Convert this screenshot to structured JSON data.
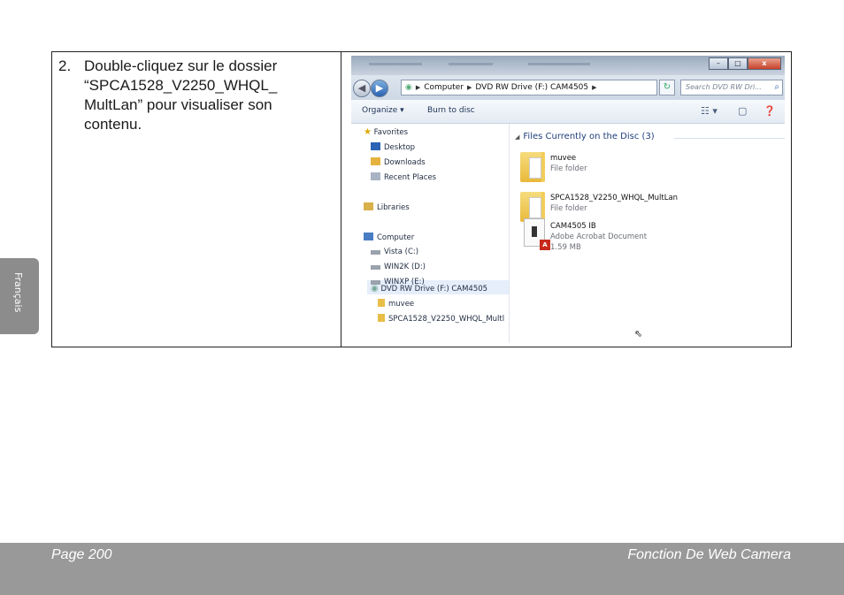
{
  "step": {
    "number": "2.",
    "text": "Double-cliquez sur le dossier\n“SPCA1528_V2250_WHQL_\nMultLan” pour visualiser son\ncontenu."
  },
  "explorer": {
    "window_buttons": [
      "–",
      "□",
      "x"
    ],
    "breadcrumb": [
      "Computer",
      "DVD RW Drive (F:) CAM4505"
    ],
    "search_placeholder": "Search DVD RW Dri...",
    "toolbar": {
      "organize": "Organize ▾",
      "burn": "Burn to disc"
    },
    "nav": {
      "favorites": "Favorites",
      "desktop": "Desktop",
      "downloads": "Downloads",
      "recent": "Recent Places",
      "libraries": "Libraries",
      "computer": "Computer",
      "vista": "Vista (C:)",
      "win2k": "WIN2K (D:)",
      "winxp": "WINXP (E:)",
      "dvd": "DVD RW Drive (F:) CAM4505",
      "muvee": "muvee",
      "spca": "SPCA1528_V2250_WHQL_Multl"
    },
    "group_header": "Files Currently on the Disc (3)",
    "files": [
      {
        "name": "muvee",
        "type": "File folder",
        "size": ""
      },
      {
        "name": "SPCA1528_V2250_WHQL_MultLan",
        "type": "File folder",
        "size": ""
      },
      {
        "name": "CAM4505 IB",
        "type": "Adobe Acrobat Document",
        "size": "1.59 MB"
      }
    ]
  },
  "side_tab": "Français",
  "footer": {
    "page": "Page 200",
    "title": "Fonction De Web Camera"
  }
}
